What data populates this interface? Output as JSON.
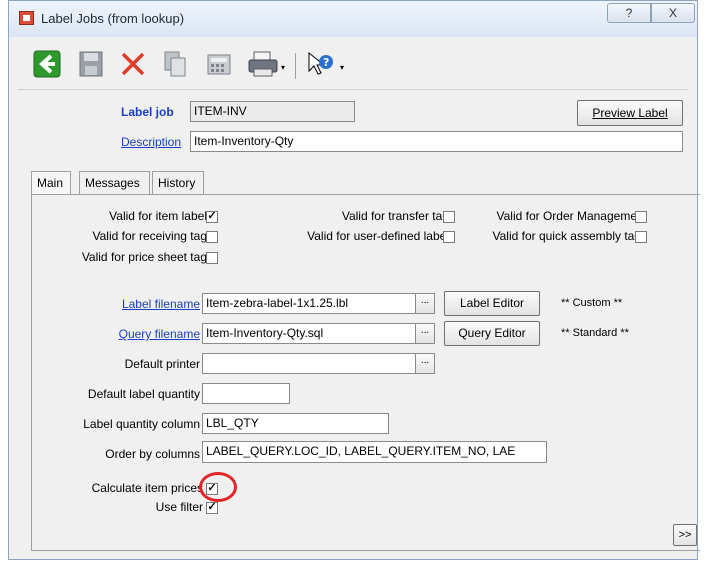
{
  "window": {
    "title": "Label Jobs (from lookup)",
    "help_glyph": "?",
    "close_glyph": "X"
  },
  "toolbar": {
    "icons": [
      "back-arrow-icon",
      "save-icon",
      "delete-icon",
      "copy-icon",
      "calculator-icon",
      "printer-icon",
      "help-pointer-icon"
    ],
    "dropdown_glyph": "▾"
  },
  "header": {
    "label_job_label": "Label job",
    "label_job_value": "ITEM-INV",
    "description_label": "Description",
    "description_value": "Item-Inventory-Qty",
    "preview_button": "Preview Label"
  },
  "tabs": [
    "Main",
    "Messages",
    "History"
  ],
  "checks": [
    {
      "label": "Valid for item labels",
      "checked": true
    },
    {
      "label": "Valid for receiving tags",
      "checked": false
    },
    {
      "label": "Valid for price sheet tags",
      "checked": false
    },
    {
      "label": "Valid for transfer tags",
      "checked": false
    },
    {
      "label": "Valid for user-defined labels",
      "checked": false
    },
    {
      "label": "Valid for Order Management",
      "checked": false
    },
    {
      "label": "Valid for quick assembly tags",
      "checked": false
    }
  ],
  "fields": {
    "label_filename_label": "Label filename",
    "label_filename_value": "Item-zebra-label-1x1.25.lbl",
    "label_editor_button": "Label Editor",
    "label_status": "** Custom **",
    "query_filename_label": "Query filename",
    "query_filename_value": "Item-Inventory-Qty.sql",
    "query_editor_button": "Query Editor",
    "query_status": "** Standard **",
    "default_printer_label": "Default printer",
    "default_printer_value": "",
    "default_qty_label": "Default label quantity",
    "default_qty_value": "",
    "qty_column_label": "Label quantity column",
    "qty_column_value": "LBL_QTY",
    "order_by_label": "Order by columns",
    "order_by_value": "LABEL_QUERY.LOC_ID, LABEL_QUERY.ITEM_NO, LAE",
    "ellipsis": "...",
    "calc_prices_label": "Calculate item prices",
    "calc_prices_checked": true,
    "use_filter_label": "Use filter",
    "use_filter_checked": true,
    "more_button": ">>",
    "check_glyph": "✓"
  }
}
